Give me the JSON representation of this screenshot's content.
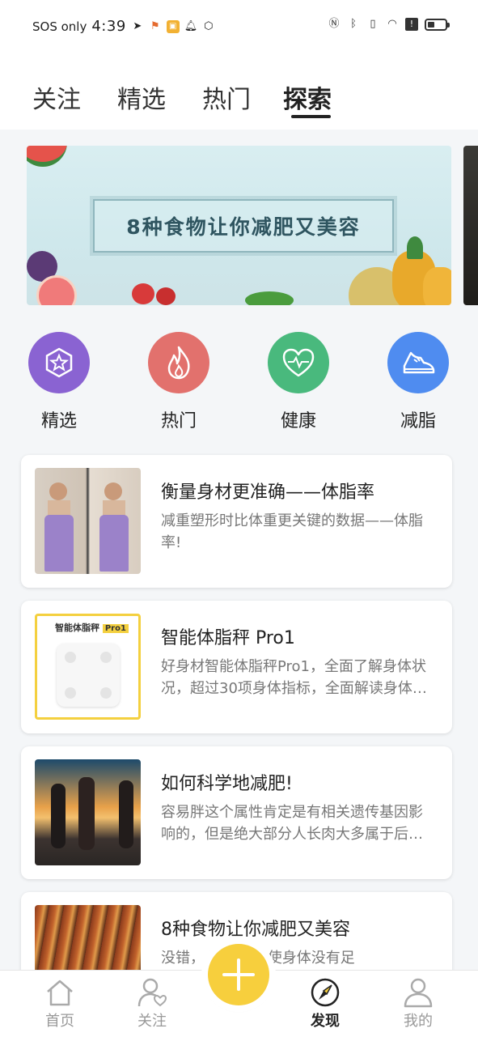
{
  "status_bar": {
    "carrier": "SOS only",
    "time": "4:39"
  },
  "top_tabs": [
    {
      "label": "关注"
    },
    {
      "label": "精选"
    },
    {
      "label": "热门"
    },
    {
      "label": "探索",
      "active": true
    }
  ],
  "banner": {
    "title": "8种食物让你减肥又美容"
  },
  "categories": [
    {
      "label": "精选",
      "icon": "star-hexagon-icon",
      "color": "#8a63d2"
    },
    {
      "label": "热门",
      "icon": "flame-icon",
      "color": "#e2716d"
    },
    {
      "label": "健康",
      "icon": "heart-pulse-icon",
      "color": "#49b97d"
    },
    {
      "label": "减脂",
      "icon": "sneaker-icon",
      "color": "#4f8cf0"
    }
  ],
  "articles": [
    {
      "title": "衡量身材更准确——体脂率",
      "desc": "减重塑形时比体重更关键的数据——体脂率!"
    },
    {
      "title": "智能体脂秤 Pro1",
      "desc": "好身材智能体脂秤Pro1，全面了解身体状况，超过30项身体指标，全面解读身体数据",
      "thumb_title": "智能体脂秤",
      "thumb_badge": "Pro1"
    },
    {
      "title": "如何科学地减肥!",
      "desc": "容易胖这个属性肯定是有相关遗传基因影响的，但是绝大部分人长肉大多属于后天原因"
    },
    {
      "title": "8种食物让你减肥又美容",
      "desc": "没错，   减肥，致使身体没有足"
    }
  ],
  "bottom_nav": [
    {
      "label": "首页",
      "icon": "home-icon"
    },
    {
      "label": "关注",
      "icon": "user-heart-icon"
    },
    {
      "label": "发现",
      "icon": "compass-icon",
      "active": true
    },
    {
      "label": "我的",
      "icon": "profile-icon"
    }
  ],
  "fab": {
    "icon": "plus-icon",
    "color": "#f7cf3d"
  }
}
